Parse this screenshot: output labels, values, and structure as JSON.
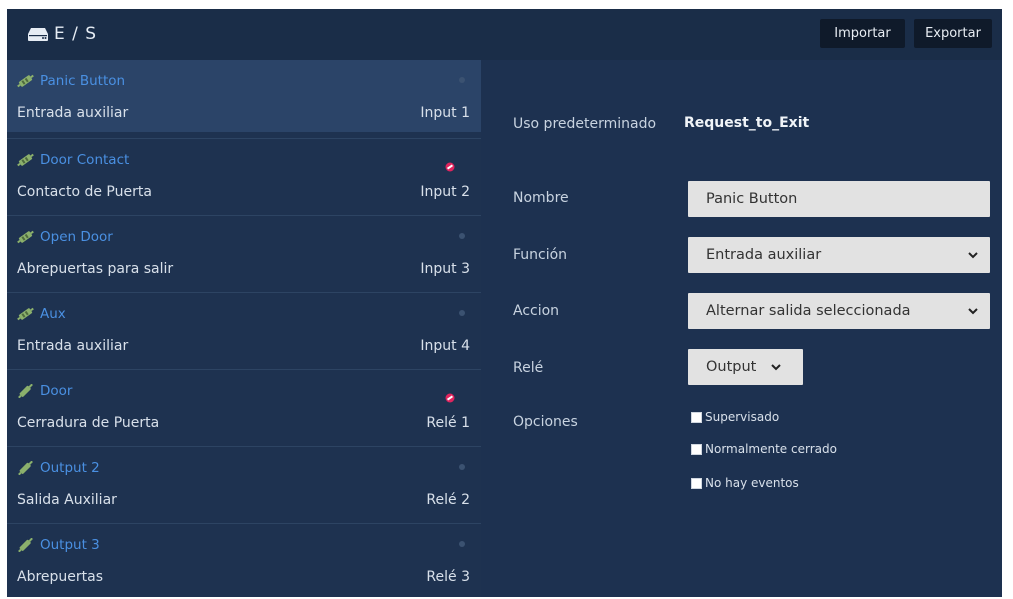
{
  "header": {
    "title": "E / S",
    "icon": "hard-drive-icon",
    "import_label": "Importar",
    "export_label": "Exportar"
  },
  "io_list": [
    {
      "name": "Panic Button",
      "function": "Entrada auxiliar",
      "port": "Input 1",
      "selected": true,
      "status_icon": null
    },
    {
      "name": "Door Contact",
      "function": "Contacto de Puerta",
      "port": "Input 2",
      "selected": false,
      "status_icon": "no-entry-icon"
    },
    {
      "name": "Open Door",
      "function": "Abrepuertas para salir",
      "port": "Input 3",
      "selected": false,
      "status_icon": null
    },
    {
      "name": "Aux",
      "function": "Entrada auxiliar",
      "port": "Input 4",
      "selected": false,
      "status_icon": null
    },
    {
      "name": "Door",
      "function": "Cerradura de Puerta",
      "port": "Relé 1",
      "selected": false,
      "status_icon": "no-entry-icon"
    },
    {
      "name": "Output 2",
      "function": "Salida Auxiliar",
      "port": "Relé 2",
      "selected": false,
      "status_icon": null
    },
    {
      "name": "Output 3",
      "function": "Abrepuertas",
      "port": "Relé 3",
      "selected": false,
      "status_icon": null
    }
  ],
  "detail": {
    "default_use_label": "Uso predeterminado",
    "default_use_value": "Request_to_Exit",
    "name_label": "Nombre",
    "name_value": "Panic Button",
    "function_label": "Función",
    "function_value": "Entrada auxiliar",
    "action_label": "Accion",
    "action_value": "Alternar salida seleccionada",
    "relay_label": "Relé",
    "relay_value": "Output",
    "options_label": "Opciones",
    "options": [
      {
        "label": "Supervisado",
        "checked": false
      },
      {
        "label": "Normalmente cerrado",
        "checked": false
      },
      {
        "label": "No hay eventos",
        "checked": false
      }
    ]
  },
  "colors": {
    "background": "#1d3150",
    "topbar": "#1a2d48",
    "selected_row": "#2b4468",
    "accent_blue": "#4a90e2",
    "io_icon_green": "#8bb06c",
    "status_red": "#e0245e"
  }
}
